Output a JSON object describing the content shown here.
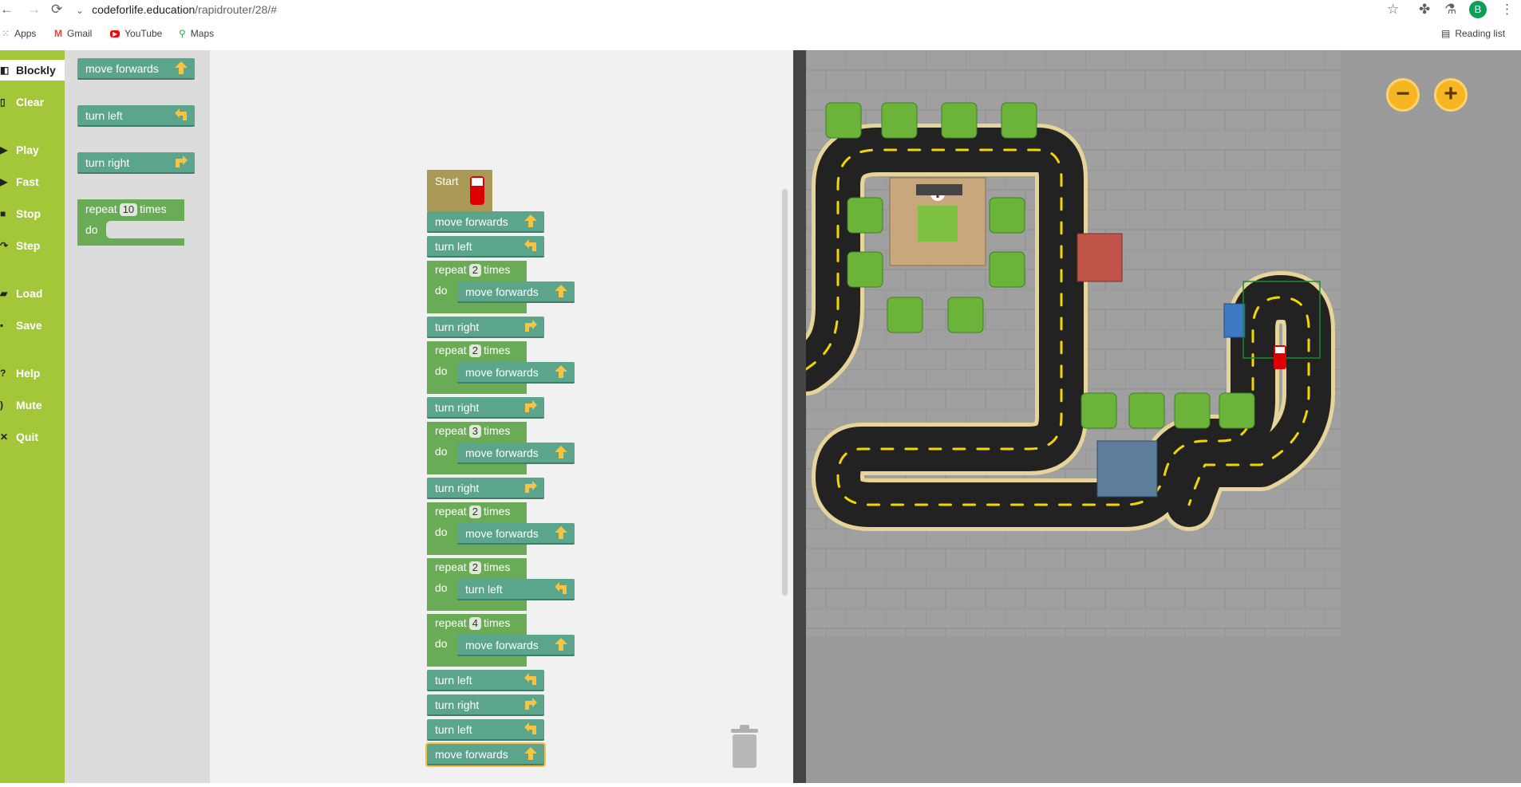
{
  "browser": {
    "url_host": "codeforlife.education",
    "url_path": "/rapidrouter/28/#",
    "profile_initial": "B",
    "bookmarks": [
      "Apps",
      "Gmail",
      "YouTube",
      "Maps"
    ],
    "reading_list": "Reading list"
  },
  "controls": [
    {
      "label": "Blockly",
      "icon": "blockly-icon",
      "active": true
    },
    {
      "label": "Clear",
      "icon": "trash-icon"
    },
    {
      "label": "Play",
      "icon": "play-icon"
    },
    {
      "label": "Fast",
      "icon": "fast-icon"
    },
    {
      "label": "Stop",
      "icon": "stop-icon"
    },
    {
      "label": "Step",
      "icon": "step-icon"
    },
    {
      "label": "Load",
      "icon": "folder-icon"
    },
    {
      "label": "Save",
      "icon": "save-icon"
    },
    {
      "label": "Help",
      "icon": "help-icon"
    },
    {
      "label": "Mute",
      "icon": "speaker-icon"
    },
    {
      "label": "Quit",
      "icon": "quit-icon"
    }
  ],
  "toolbox": {
    "move_forwards": "move forwards",
    "turn_left": "turn left",
    "turn_right": "turn right",
    "repeat": "repeat",
    "repeat_count": "10",
    "times": "times",
    "do": "do"
  },
  "program": {
    "start": "Start",
    "blocks": [
      {
        "type": "simple",
        "label": "move forwards",
        "icon": "up-arrow-icon"
      },
      {
        "type": "simple",
        "label": "turn left",
        "icon": "left-arrow-icon"
      },
      {
        "type": "repeat",
        "count": "2",
        "inner": "move forwards",
        "icon": "up-arrow-icon"
      },
      {
        "type": "simple",
        "label": "turn right",
        "icon": "right-arrow-icon"
      },
      {
        "type": "repeat",
        "count": "2",
        "inner": "move forwards",
        "icon": "up-arrow-icon"
      },
      {
        "type": "simple",
        "label": "turn right",
        "icon": "right-arrow-icon"
      },
      {
        "type": "repeat",
        "count": "3",
        "inner": "move forwards",
        "icon": "up-arrow-icon"
      },
      {
        "type": "simple",
        "label": "turn right",
        "icon": "right-arrow-icon"
      },
      {
        "type": "repeat",
        "count": "2",
        "inner": "move forwards",
        "icon": "up-arrow-icon"
      },
      {
        "type": "repeat",
        "count": "2",
        "inner": "turn left",
        "icon": "left-arrow-icon"
      },
      {
        "type": "repeat",
        "count": "4",
        "inner": "move forwards",
        "icon": "up-arrow-icon"
      },
      {
        "type": "simple",
        "label": "turn left",
        "icon": "left-arrow-icon"
      },
      {
        "type": "simple",
        "label": "turn right",
        "icon": "right-arrow-icon"
      },
      {
        "type": "simple",
        "label": "turn left",
        "icon": "left-arrow-icon"
      },
      {
        "type": "simple",
        "label": "move forwards",
        "icon": "up-arrow-icon",
        "selected": true
      }
    ],
    "repeat_word": "repeat",
    "times_word": "times",
    "do_word": "do"
  },
  "map": {
    "zoom_out": "−",
    "zoom_in": "+",
    "colors": {
      "road": "#222222",
      "road_edge": "#e6d49a",
      "lane": "#f2d600",
      "grass": "#6cb33a",
      "map_bg": "#9a9a9a"
    }
  }
}
